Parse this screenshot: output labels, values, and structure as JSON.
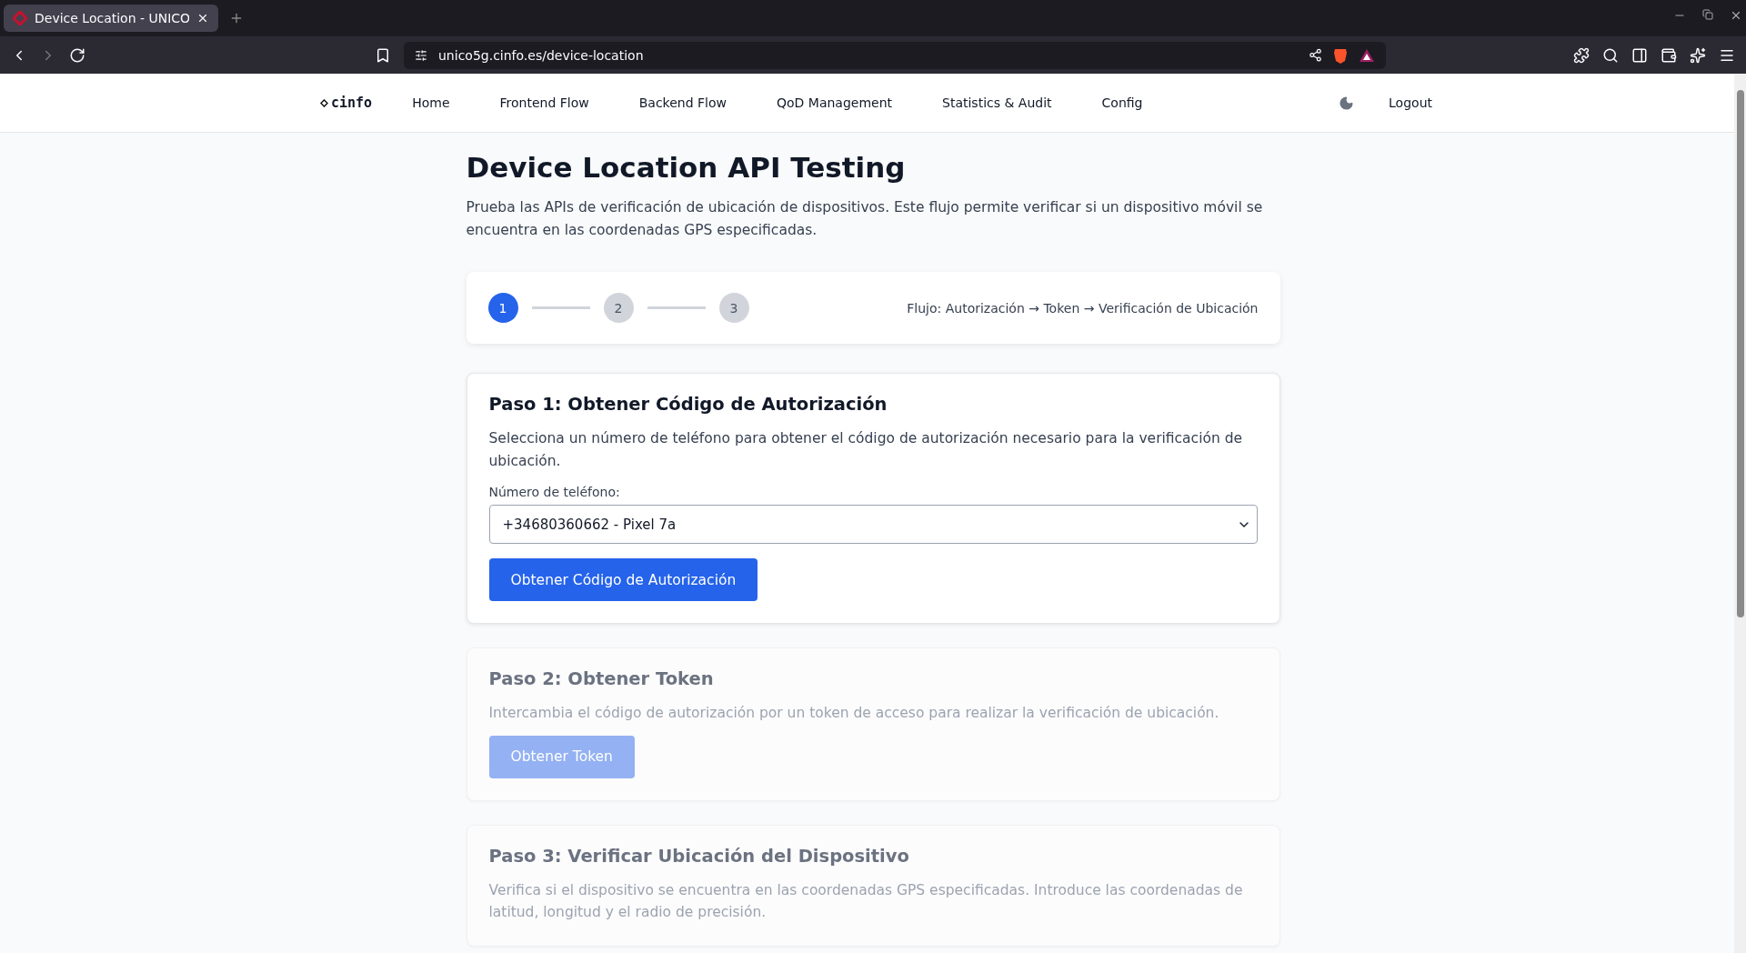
{
  "browser": {
    "tab_title": "Device Location - UNICO",
    "url": "unico5g.cinfo.es/device-location"
  },
  "nav": {
    "logo": "cinfo",
    "items": [
      {
        "label": "Home"
      },
      {
        "label": "Frontend Flow"
      },
      {
        "label": "Backend Flow"
      },
      {
        "label": "QoD Management"
      },
      {
        "label": "Statistics & Audit"
      },
      {
        "label": "Config"
      }
    ],
    "logout": "Logout"
  },
  "page": {
    "title": "Device Location API Testing",
    "description": "Prueba las APIs de verificación de ubicación de dispositivos. Este flujo permite verificar si un dispositivo móvil se encuentra en las coordenadas GPS especificadas."
  },
  "stepper": {
    "steps": [
      {
        "label": "1",
        "selected": true
      },
      {
        "label": "2",
        "selected": false
      },
      {
        "label": "3",
        "selected": false
      }
    ],
    "flow": "Flujo: Autorización → Token → Verificación de Ubicación"
  },
  "cards": [
    {
      "kind": "form",
      "disabled": false,
      "title": "Paso 1: Obtener Código de Autorización",
      "description": "Selecciona un número de teléfono para obtener el código de autorización necesario para la verificación de ubicación.",
      "field_label": "Número de teléfono:",
      "select_value": "+34680360662 - Pixel 7a",
      "button": "Obtener Código de Autorización"
    },
    {
      "kind": "action",
      "disabled": true,
      "title": "Paso 2: Obtener Token",
      "description": "Intercambia el código de autorización por un token de acceso para realizar la verificación de ubicación.",
      "button": "Obtener Token"
    },
    {
      "kind": "info",
      "disabled": true,
      "title": "Paso 3: Verificar Ubicación del Dispositivo",
      "description": "Verifica si el dispositivo se encuentra en las coordenadas GPS especificadas. Introduce las coordenadas de latitud, longitud y el radio de precisión."
    }
  ]
}
